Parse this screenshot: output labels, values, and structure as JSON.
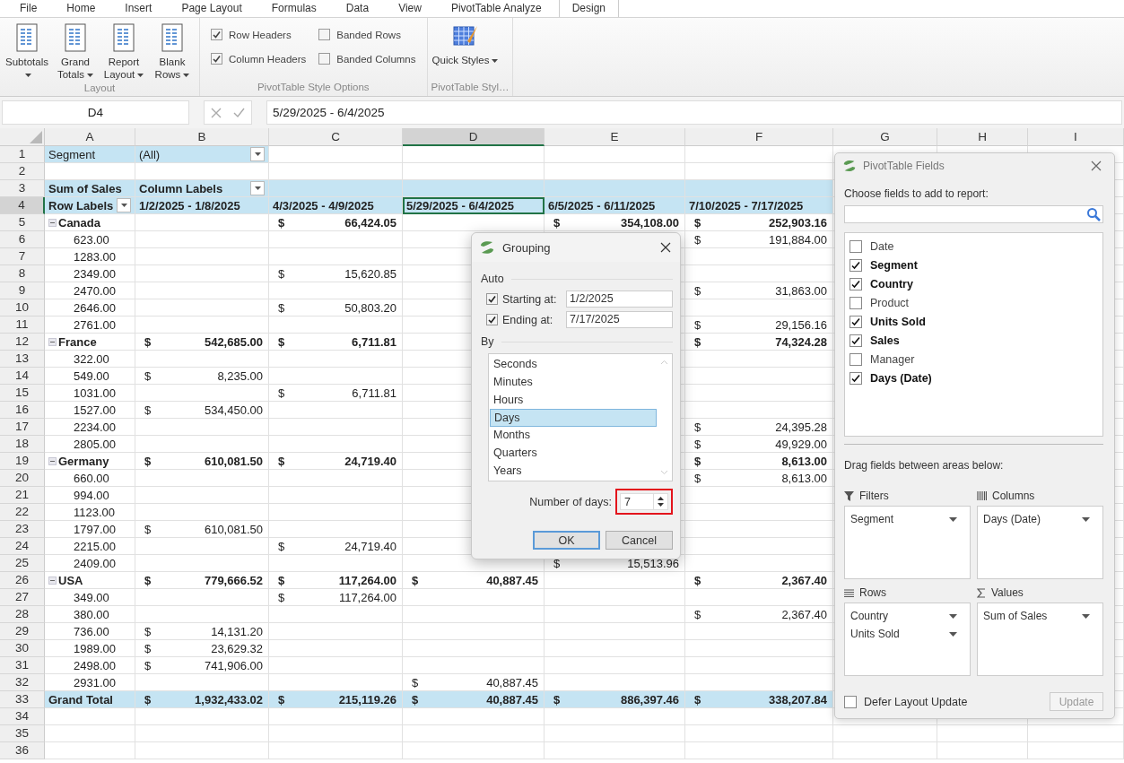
{
  "ribbon": {
    "tabs": [
      {
        "label": "File",
        "selected": false
      },
      {
        "label": "Home",
        "selected": false
      },
      {
        "label": "Insert",
        "selected": false
      },
      {
        "label": "Page Layout",
        "selected": false
      },
      {
        "label": "Formulas",
        "selected": false
      },
      {
        "label": "Data",
        "selected": false
      },
      {
        "label": "View",
        "selected": false
      },
      {
        "label": "PivotTable Analyze",
        "selected": false
      },
      {
        "label": "Design",
        "selected": true
      }
    ],
    "groups": [
      {
        "kind": "buttons",
        "label": "Layout",
        "buttons": [
          {
            "label": "Subtotals",
            "dropdown": true
          },
          {
            "label": "Grand Totals",
            "dropdown": true
          },
          {
            "label": "Report Layout",
            "dropdown": true
          },
          {
            "label": "Blank Rows",
            "dropdown": true
          }
        ]
      },
      {
        "kind": "options",
        "label": "PivotTable Style Options",
        "options": [
          {
            "label": "Row Headers",
            "checked": true
          },
          {
            "label": "Banded Rows",
            "checked": false
          },
          {
            "label": "Column Headers",
            "checked": true
          },
          {
            "label": "Banded Columns",
            "checked": false
          }
        ]
      },
      {
        "kind": "styles",
        "label": "PivotTable Styl…",
        "buttons": [
          {
            "label": "Quick Styles",
            "dropdown": true
          }
        ]
      }
    ]
  },
  "formula_bar": {
    "name_box": "D4",
    "formula": "5/29/2025 - 6/4/2025"
  },
  "sheet": {
    "columns": [
      {
        "label": "A",
        "selected": false
      },
      {
        "label": "B",
        "selected": false
      },
      {
        "label": "C",
        "selected": false
      },
      {
        "label": "D",
        "selected": true
      },
      {
        "label": "E",
        "selected": false
      },
      {
        "label": "F",
        "selected": false
      },
      {
        "label": "G",
        "selected": false
      },
      {
        "label": "H",
        "selected": false
      },
      {
        "label": "I",
        "selected": false
      }
    ],
    "rows": [
      {
        "n": "1",
        "kind": "filter",
        "selected": false,
        "cells": {
          "A": {
            "text": "Segment"
          },
          "B": {
            "text": "(All)",
            "dropdown": true
          }
        }
      },
      {
        "n": "2",
        "kind": "blank",
        "selected": false
      },
      {
        "n": "3",
        "kind": "header",
        "selected": false,
        "cells": {
          "A": {
            "text": "Sum of Sales"
          },
          "B": {
            "text": "Column Labels",
            "dropdown": true
          }
        }
      },
      {
        "n": "4",
        "kind": "header",
        "selected": true,
        "cells": {
          "A": {
            "text": "Row Labels",
            "dropdown": true
          },
          "B": {
            "text": "1/2/2025 - 1/8/2025"
          },
          "C": {
            "text": "4/3/2025 - 4/9/2025"
          },
          "D": {
            "text": "5/29/2025 - 6/4/2025"
          },
          "E": {
            "text": "6/5/2025 - 6/11/2025"
          },
          "F": {
            "text": "7/10/2025 - 7/17/2025"
          }
        }
      },
      {
        "n": "5",
        "kind": "group",
        "selected": false,
        "cells": {
          "A": {
            "text": "Canada",
            "expanded": true
          },
          "C": {
            "currency": "$",
            "amount": "66,424.05"
          },
          "E": {
            "currency": "$",
            "amount": "354,108.00"
          },
          "F": {
            "currency": "$",
            "amount": "252,903.16"
          }
        }
      },
      {
        "n": "6",
        "kind": "item",
        "selected": false,
        "cells": {
          "A": {
            "text": "623.00"
          },
          "F": {
            "currency": "$",
            "amount": "191,884.00"
          }
        }
      },
      {
        "n": "7",
        "kind": "item",
        "selected": false,
        "cells": {
          "A": {
            "text": "1283.00"
          }
        }
      },
      {
        "n": "8",
        "kind": "item",
        "selected": false,
        "cells": {
          "A": {
            "text": "2349.00"
          },
          "C": {
            "currency": "$",
            "amount": "15,620.85"
          }
        }
      },
      {
        "n": "9",
        "kind": "item",
        "selected": false,
        "cells": {
          "A": {
            "text": "2470.00"
          },
          "F": {
            "currency": "$",
            "amount": "31,863.00"
          }
        }
      },
      {
        "n": "10",
        "kind": "item",
        "selected": false,
        "cells": {
          "A": {
            "text": "2646.00"
          },
          "C": {
            "currency": "$",
            "amount": "50,803.20"
          }
        }
      },
      {
        "n": "11",
        "kind": "item",
        "selected": false,
        "cells": {
          "A": {
            "text": "2761.00"
          },
          "F": {
            "currency": "$",
            "amount": "29,156.16"
          }
        }
      },
      {
        "n": "12",
        "kind": "group",
        "selected": false,
        "cells": {
          "A": {
            "text": "France",
            "expanded": true
          },
          "B": {
            "currency": "$",
            "amount": "542,685.00"
          },
          "C": {
            "currency": "$",
            "amount": "6,711.81"
          },
          "F": {
            "currency": "$",
            "amount": "74,324.28"
          }
        }
      },
      {
        "n": "13",
        "kind": "item",
        "selected": false,
        "cells": {
          "A": {
            "text": "322.00"
          }
        }
      },
      {
        "n": "14",
        "kind": "item",
        "selected": false,
        "cells": {
          "A": {
            "text": "549.00"
          },
          "B": {
            "currency": "$",
            "amount": "8,235.00"
          }
        }
      },
      {
        "n": "15",
        "kind": "item",
        "selected": false,
        "cells": {
          "A": {
            "text": "1031.00"
          },
          "C": {
            "currency": "$",
            "amount": "6,711.81"
          }
        }
      },
      {
        "n": "16",
        "kind": "item",
        "selected": false,
        "cells": {
          "A": {
            "text": "1527.00"
          },
          "B": {
            "currency": "$",
            "amount": "534,450.00"
          }
        }
      },
      {
        "n": "17",
        "kind": "item",
        "selected": false,
        "cells": {
          "A": {
            "text": "2234.00"
          },
          "F": {
            "currency": "$",
            "amount": "24,395.28"
          }
        }
      },
      {
        "n": "18",
        "kind": "item",
        "selected": false,
        "cells": {
          "A": {
            "text": "2805.00"
          },
          "F": {
            "currency": "$",
            "amount": "49,929.00"
          }
        }
      },
      {
        "n": "19",
        "kind": "group",
        "selected": false,
        "cells": {
          "A": {
            "text": "Germany",
            "expanded": true
          },
          "B": {
            "currency": "$",
            "amount": "610,081.50"
          },
          "C": {
            "currency": "$",
            "amount": "24,719.40"
          },
          "F": {
            "currency": "$",
            "amount": "8,613.00"
          }
        }
      },
      {
        "n": "20",
        "kind": "item",
        "selected": false,
        "cells": {
          "A": {
            "text": "660.00"
          },
          "F": {
            "currency": "$",
            "amount": "8,613.00"
          }
        }
      },
      {
        "n": "21",
        "kind": "item",
        "selected": false,
        "cells": {
          "A": {
            "text": "994.00"
          }
        }
      },
      {
        "n": "22",
        "kind": "item",
        "selected": false,
        "cells": {
          "A": {
            "text": "1123.00"
          }
        }
      },
      {
        "n": "23",
        "kind": "item",
        "selected": false,
        "cells": {
          "A": {
            "text": "1797.00"
          },
          "B": {
            "currency": "$",
            "amount": "610,081.50"
          }
        }
      },
      {
        "n": "24",
        "kind": "item",
        "selected": false,
        "cells": {
          "A": {
            "text": "2215.00"
          },
          "C": {
            "currency": "$",
            "amount": "24,719.40"
          }
        }
      },
      {
        "n": "25",
        "kind": "item",
        "selected": false,
        "cells": {
          "A": {
            "text": "2409.00"
          },
          "E": {
            "currency": "$",
            "amount": "15,513.96"
          }
        }
      },
      {
        "n": "26",
        "kind": "group",
        "selected": false,
        "cells": {
          "A": {
            "text": "USA",
            "expanded": true
          },
          "B": {
            "currency": "$",
            "amount": "779,666.52"
          },
          "C": {
            "currency": "$",
            "amount": "117,264.00"
          },
          "D": {
            "currency": "$",
            "amount": "40,887.45"
          },
          "F": {
            "currency": "$",
            "amount": "2,367.40"
          }
        }
      },
      {
        "n": "27",
        "kind": "item",
        "selected": false,
        "cells": {
          "A": {
            "text": "349.00"
          },
          "C": {
            "currency": "$",
            "amount": "117,264.00"
          }
        }
      },
      {
        "n": "28",
        "kind": "item",
        "selected": false,
        "cells": {
          "A": {
            "text": "380.00"
          },
          "F": {
            "currency": "$",
            "amount": "2,367.40"
          }
        }
      },
      {
        "n": "29",
        "kind": "item",
        "selected": false,
        "cells": {
          "A": {
            "text": "736.00"
          },
          "B": {
            "currency": "$",
            "amount": "14,131.20"
          }
        }
      },
      {
        "n": "30",
        "kind": "item",
        "selected": false,
        "cells": {
          "A": {
            "text": "1989.00"
          },
          "B": {
            "currency": "$",
            "amount": "23,629.32"
          }
        }
      },
      {
        "n": "31",
        "kind": "item",
        "selected": false,
        "cells": {
          "A": {
            "text": "2498.00"
          },
          "B": {
            "currency": "$",
            "amount": "741,906.00"
          }
        }
      },
      {
        "n": "32",
        "kind": "item",
        "selected": false,
        "cells": {
          "A": {
            "text": "2931.00"
          },
          "D": {
            "currency": "$",
            "amount": "40,887.45"
          }
        }
      },
      {
        "n": "33",
        "kind": "total",
        "selected": false,
        "cells": {
          "A": {
            "text": "Grand Total"
          },
          "B": {
            "currency": "$",
            "amount": "1,932,433.02"
          },
          "C": {
            "currency": "$",
            "amount": "215,119.26"
          },
          "D": {
            "currency": "$",
            "amount": "40,887.45"
          },
          "E": {
            "currency": "$",
            "amount": "886,397.46"
          },
          "F": {
            "currency": "$",
            "amount": "338,207.84"
          }
        }
      },
      {
        "n": "34",
        "kind": "blank",
        "selected": false
      },
      {
        "n": "35",
        "kind": "blank",
        "selected": false
      },
      {
        "n": "36",
        "kind": "blank",
        "selected": false
      }
    ]
  },
  "grouping_dialog": {
    "title": "Grouping",
    "auto_label": "Auto",
    "bounds": [
      {
        "label": "Starting at:",
        "checked": true,
        "value": "1/2/2025"
      },
      {
        "label": "Ending at:",
        "checked": true,
        "value": "7/17/2025"
      }
    ],
    "by_label": "By",
    "units": [
      {
        "label": "Seconds",
        "selected": false
      },
      {
        "label": "Minutes",
        "selected": false
      },
      {
        "label": "Hours",
        "selected": false
      },
      {
        "label": "Days",
        "selected": true
      },
      {
        "label": "Months",
        "selected": false
      },
      {
        "label": "Quarters",
        "selected": false
      },
      {
        "label": "Years",
        "selected": false
      }
    ],
    "days_label": "Number of days:",
    "days_value": "7",
    "days_highlighted": true,
    "buttons": [
      {
        "label": "OK",
        "kind": "default"
      },
      {
        "label": "Cancel",
        "kind": "normal"
      }
    ]
  },
  "fields_panel": {
    "title": "PivotTable Fields",
    "prompt": "Choose fields to add to report:",
    "fields": [
      {
        "label": "Date",
        "checked": false
      },
      {
        "label": "Segment",
        "checked": true
      },
      {
        "label": "Country",
        "checked": true
      },
      {
        "label": "Product",
        "checked": false
      },
      {
        "label": "Units Sold",
        "checked": true
      },
      {
        "label": "Sales",
        "checked": true
      },
      {
        "label": "Manager",
        "checked": false
      },
      {
        "label": "Days (Date)",
        "checked": true
      }
    ],
    "areas_prompt": "Drag fields between areas below:",
    "areas": [
      {
        "kind": "filters",
        "title": "Filters",
        "items": [
          "Segment"
        ]
      },
      {
        "kind": "columns",
        "title": "Columns",
        "items": [
          "Days (Date)"
        ]
      },
      {
        "kind": "rows",
        "title": "Rows",
        "items": [
          "Country",
          "Units Sold"
        ]
      },
      {
        "kind": "values",
        "title": "Values",
        "items": [
          "Sum of Sales"
        ]
      }
    ],
    "defer": {
      "label": "Defer Layout Update",
      "checked": false
    },
    "update_button": {
      "label": "Update",
      "disabled": true
    }
  }
}
